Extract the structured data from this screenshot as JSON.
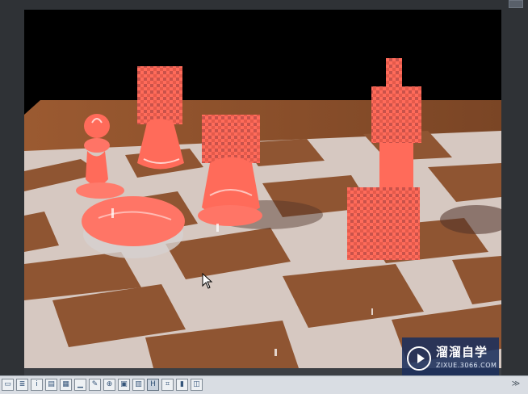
{
  "toolbar": {
    "icons": [
      "panel-icon",
      "list-icon",
      "info-icon",
      "table-icon",
      "chart-icon",
      "edit-icon",
      "target-icon",
      "image-icon",
      "grid-icon",
      "h-icon",
      "crop-icon",
      "bars-icon",
      "window-icon"
    ],
    "active_index": 9,
    "expand_label": "≫"
  },
  "watermark": {
    "title": "溜溜自学",
    "subtitle": "ZIXUE.3066.COM"
  },
  "colors": {
    "piece": "#ff6b5a",
    "board_dark": "#8f5532",
    "board_light": "#e7ddd7",
    "watermark_bg": "#1c305c"
  }
}
